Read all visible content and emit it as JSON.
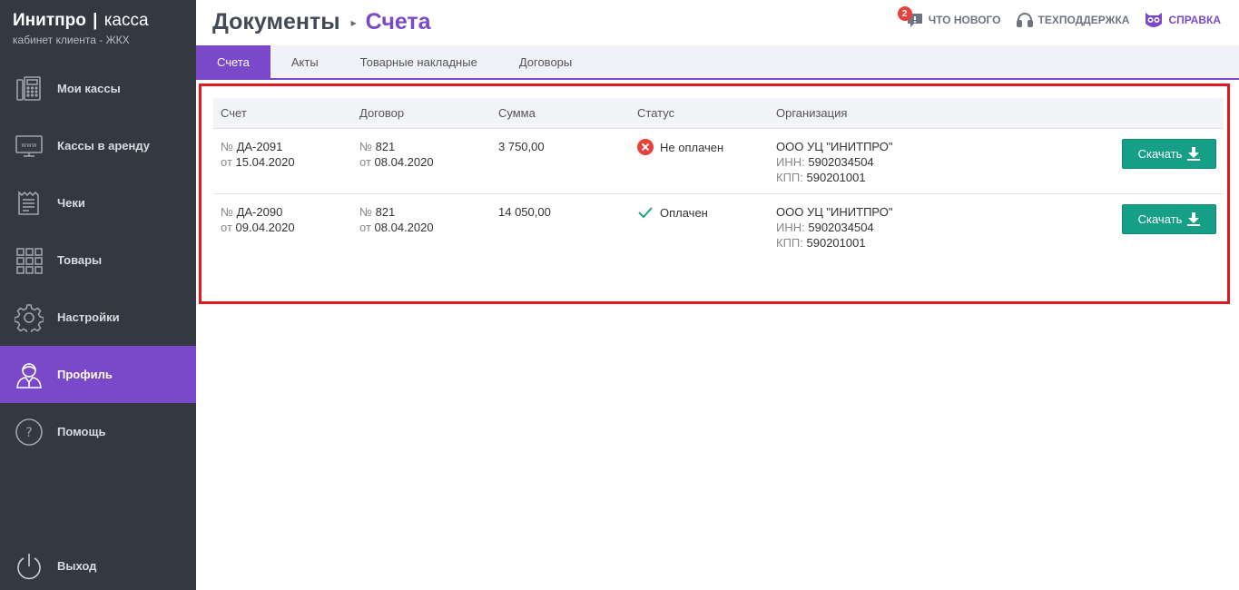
{
  "brand": {
    "name": "Инитпро",
    "separator": "|",
    "product": "касса",
    "subtitle": "кабинет клиента - ЖКХ"
  },
  "sidebar": {
    "items": [
      {
        "label": "Мои кассы",
        "icon": "cash-register-icon"
      },
      {
        "label": "Кассы в аренду",
        "icon": "www-monitor-icon"
      },
      {
        "label": "Чеки",
        "icon": "receipt-icon"
      },
      {
        "label": "Товары",
        "icon": "grid-icon"
      },
      {
        "label": "Настройки",
        "icon": "gear-icon"
      },
      {
        "label": "Профиль",
        "icon": "user-icon",
        "active": true
      },
      {
        "label": "Помощь",
        "icon": "question-icon"
      }
    ],
    "logout": {
      "label": "Выход",
      "icon": "power-icon"
    }
  },
  "header": {
    "breadcrumb_root": "Документы",
    "breadcrumb_current": "Счета",
    "whats_new": "ЧТО НОВОГО",
    "whats_new_badge": "2",
    "support": "ТЕХПОДДЕРЖКА",
    "help": "СПРАВКА"
  },
  "tabs": [
    {
      "label": "Счета",
      "active": true
    },
    {
      "label": "Акты"
    },
    {
      "label": "Товарные накладные"
    },
    {
      "label": "Договоры"
    }
  ],
  "table": {
    "headers": [
      "Счет",
      "Договор",
      "Сумма",
      "Статус",
      "Организация"
    ],
    "rows": [
      {
        "invoice_prefix": "№",
        "invoice_no": "ДА-2091",
        "invoice_date_prefix": "от",
        "invoice_date": "15.04.2020",
        "contract_prefix": "№",
        "contract_no": "821",
        "contract_date_prefix": "от",
        "contract_date": "08.04.2020",
        "amount": "3 750,00",
        "status": "Не оплачен",
        "status_icon": "cross-circle-icon",
        "org_name": "ООО УЦ \"ИНИТПРО\"",
        "inn_label": "ИНН:",
        "inn": "5902034504",
        "kpp_label": "КПП:",
        "kpp": "590201001",
        "button": "Скачать"
      },
      {
        "invoice_prefix": "№",
        "invoice_no": "ДА-2090",
        "invoice_date_prefix": "от",
        "invoice_date": "09.04.2020",
        "contract_prefix": "№",
        "contract_no": "821",
        "contract_date_prefix": "от",
        "contract_date": "08.04.2020",
        "amount": "14 050,00",
        "status": "Оплачен",
        "status_icon": "checkmark-icon",
        "org_name": "ООО УЦ \"ИНИТПРО\"",
        "inn_label": "ИНН:",
        "inn": "5902034504",
        "kpp_label": "КПП:",
        "kpp": "590201001",
        "button": "Скачать"
      }
    ]
  },
  "colors": {
    "accent": "#7a49c9",
    "sidebar": "#343841",
    "download": "#149f86",
    "error": "#e8413c",
    "paid": "#1ea387",
    "highlight": "#e3191e"
  }
}
